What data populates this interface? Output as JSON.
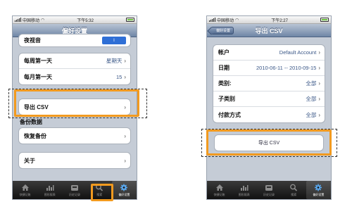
{
  "colors": {
    "highlight": "#f29a1f",
    "navbar": "#6f86a6",
    "value_text": "#3a5787"
  },
  "left": {
    "status": {
      "carrier": "中国移动",
      "time": "下午5:32"
    },
    "nav_title": "偏好设置",
    "partial_label": "夜视音",
    "toggle_label": "I",
    "rows_group1": [
      {
        "label": "每周第一天",
        "value": "星期天"
      },
      {
        "label": "每月第一天",
        "value": "15"
      }
    ],
    "export_label": "导出 CSV",
    "backup_label": "备份数据",
    "restore_label": "恢复备份",
    "about_label": "关于"
  },
  "right": {
    "status": {
      "carrier": "中国移动",
      "time": "下午2:27"
    },
    "back_label": "偏好设置",
    "nav_title": "导出 CSV",
    "rows": [
      {
        "label": "帐户",
        "value": "Default Account"
      },
      {
        "label": "日期",
        "value": "2010-06-11 -- 2010-09-15"
      },
      {
        "label": "类别:",
        "value": "全部"
      },
      {
        "label": "子类别",
        "value": "全部"
      },
      {
        "label": "付款方式",
        "value": "全部"
      }
    ],
    "export_button": "导出 CSV"
  },
  "tabs": [
    {
      "label": "快捷记账",
      "icon": "house-icon"
    },
    {
      "label": "图形报表",
      "icon": "chart-icon"
    },
    {
      "label": "历史记录",
      "icon": "inbox-icon"
    },
    {
      "label": "搜索",
      "icon": "search-icon"
    },
    {
      "label": "偏好设置",
      "icon": "gear-icon"
    }
  ]
}
